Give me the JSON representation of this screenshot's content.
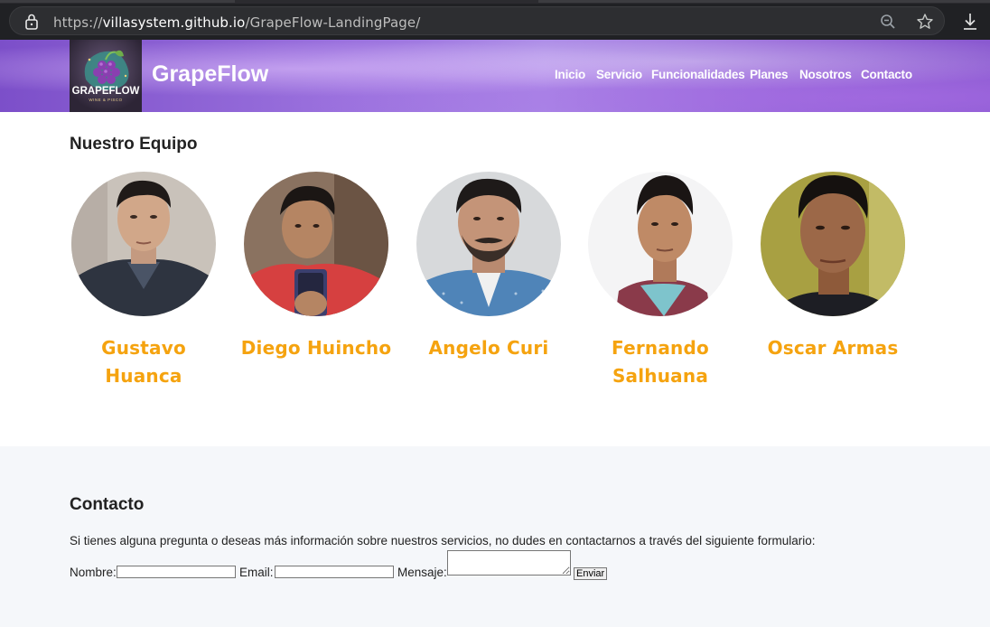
{
  "browser": {
    "url_prefix": "https://",
    "url_host": "villasystem.github.io",
    "url_path": "/GrapeFlow-LandingPage/"
  },
  "header": {
    "logo_text": "GRAPEFLOW",
    "logo_subtext": "WINE & PISCO",
    "brand": "GrapeFlow",
    "nav": [
      "Inicio",
      "Servicio",
      "Funcionalidades",
      "Planes",
      "Nosotros",
      "Contacto"
    ]
  },
  "team": {
    "title": "Nuestro Equipo",
    "members": [
      {
        "name": "Gustavo Huanca"
      },
      {
        "name": "Diego Huincho"
      },
      {
        "name": "Angelo Curi"
      },
      {
        "name": "Fernando Salhuana"
      },
      {
        "name": "Oscar Armas"
      }
    ]
  },
  "contact": {
    "title": "Contacto",
    "description": "Si tienes alguna pregunta o deseas más información sobre nuestros servicios, no dudes en contactarnos a través del siguiente formulario:",
    "name_label": "Nombre:",
    "email_label": "Email:",
    "message_label": "Mensaje:",
    "name_value": "",
    "email_value": "",
    "message_value": "",
    "submit_label": "Enviar"
  },
  "colors": {
    "accent_name": "#f5a30f",
    "header_purple": "#9b72de",
    "contact_bg": "#f5f7fa"
  }
}
